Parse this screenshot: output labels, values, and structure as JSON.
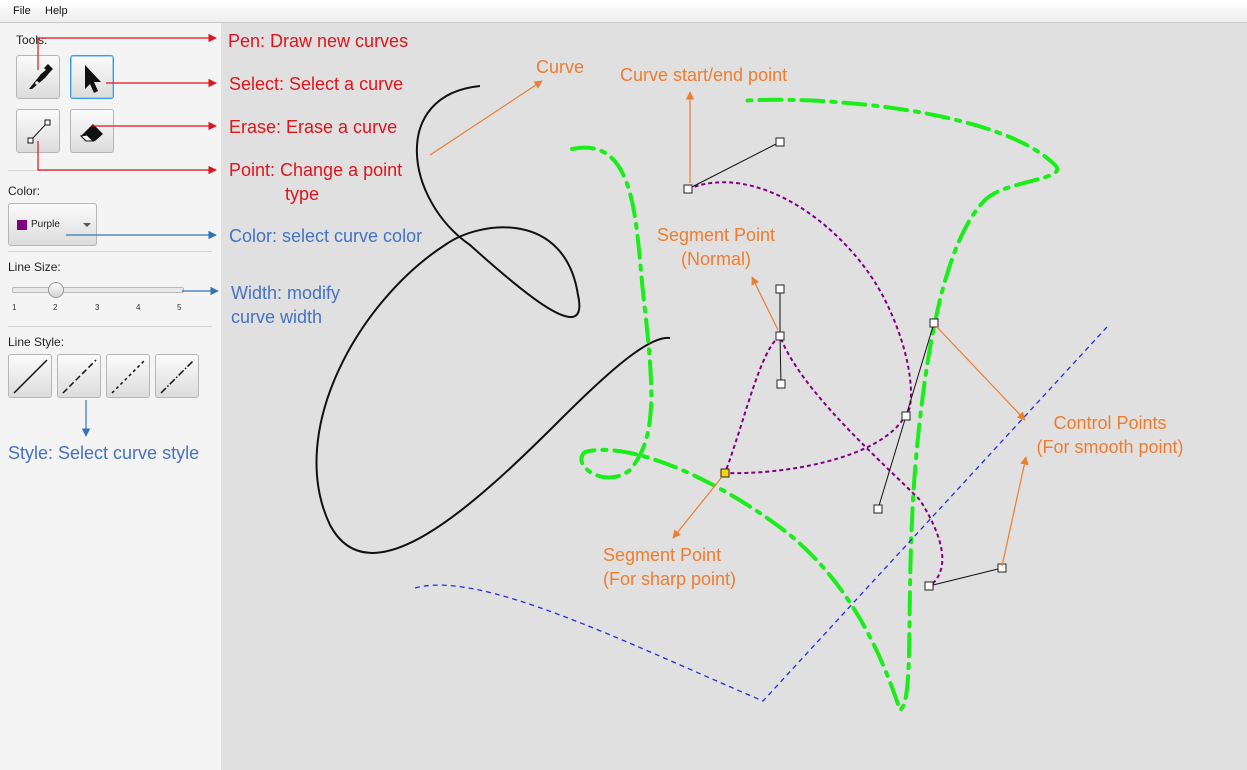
{
  "menu": {
    "file": "File",
    "help": "Help"
  },
  "sidebar": {
    "tools_label": "Tools:",
    "tools": [
      {
        "name": "pen",
        "icon": "pen-icon",
        "active": false
      },
      {
        "name": "select",
        "icon": "cursor-arrow-icon",
        "active": true
      },
      {
        "name": "point",
        "icon": "point-curve-icon",
        "active": false
      },
      {
        "name": "erase",
        "icon": "eraser-icon",
        "active": false
      }
    ],
    "color_label": "Color:",
    "color": {
      "selected": "Purple",
      "swatch": "#800080"
    },
    "line_size_label": "Line Size:",
    "line_size": {
      "value": 2,
      "min": 1,
      "max": 5,
      "ticks": [
        "1",
        "2",
        "3",
        "4",
        "5"
      ]
    },
    "line_style_label": "Line Style:",
    "line_styles": [
      "solid",
      "dashed",
      "dotted",
      "dash-dot"
    ]
  },
  "annotations": {
    "pen": "Pen: Draw new curves",
    "select": "Select: Select a curve",
    "erase": "Erase: Erase a curve",
    "point_line1": "Point: Change a point",
    "point_line2": "type",
    "color": "Color: select curve color",
    "width_line1": "Width: modify",
    "width_line2": "curve width",
    "style": "Style: Select curve style",
    "curve": "Curve",
    "start_end": "Curve start/end point",
    "segment_normal_line1": "Segment Point",
    "segment_normal_line2": "(Normal)",
    "control_line1": "Control Points",
    "control_line2": "(For smooth point)",
    "segment_sharp_line1": "Segment Point",
    "segment_sharp_line2": "(For sharp point)"
  },
  "colors": {
    "annotation_red": "#e0141c",
    "annotation_blue": "#4472c4",
    "annotation_orange": "#ed7d31",
    "curve_black": "#111111",
    "curve_green": "#1aee1a",
    "curve_blue": "#1f2fe0",
    "curve_purple": "#800080",
    "selected_point": "#ffd400"
  }
}
